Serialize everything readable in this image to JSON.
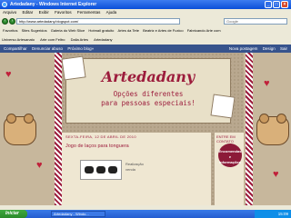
{
  "window": {
    "title": "Artedadany - Windows Internet Explorer"
  },
  "menu": {
    "items": [
      "Arquivo",
      "Editar",
      "Exibir",
      "Favoritos",
      "Ferramentas",
      "Ajuda"
    ]
  },
  "address": {
    "url": "http://www.artedadany.blogspot.com/",
    "search": "Google"
  },
  "favorites": {
    "label": "Favoritos",
    "items": [
      "Sites Sugeridos",
      "Galeria do Web Slice",
      "Hotmail gratuito",
      "Artes da Tete",
      "Beatriz e Artes de Fuxico",
      "Fabricando Arte com"
    ]
  },
  "tabs": {
    "items": [
      "Universo Artesanato",
      "Arte com Feltro",
      "Dalia Artes",
      "Artedadany"
    ]
  },
  "blogger": {
    "items": [
      "Compartilhar",
      "Denunciar abuso",
      "Próximo blog»"
    ],
    "right": [
      "Nova postagem",
      "Design",
      "Sair"
    ]
  },
  "header": {
    "title": "Artedadany",
    "subtitle_line1": "Opções diferentes",
    "subtitle_line2": "para pessoas especiais!"
  },
  "post": {
    "date": "SEXTA-FEIRA, 12 DE ABRIL DE 2010",
    "title": "Jogo de laços para tonguera",
    "caption1": "Realização",
    "caption2": "venda"
  },
  "sidebar": {
    "heading": "ENTRE EM CONTATO",
    "bubble_line1": "Encomendas",
    "bubble_line2": "e",
    "bubble_line3": "Informações"
  },
  "taskbar": {
    "start": "Iniciar",
    "task1": "Artedadany - Windo...",
    "clock": "15:09"
  }
}
